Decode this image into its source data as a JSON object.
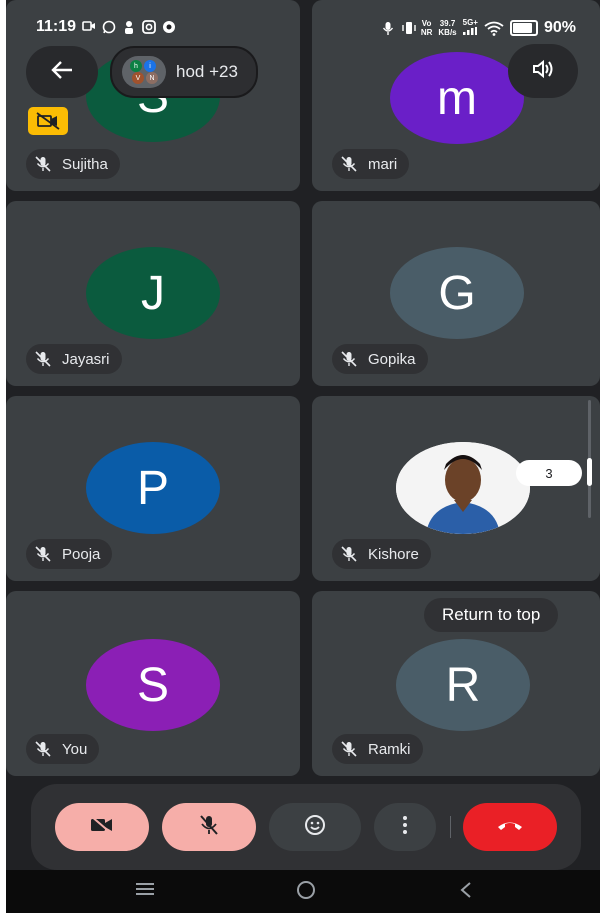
{
  "status_bar": {
    "time": "11:19",
    "net_speed_value": "39.7",
    "net_speed_unit": "KB/s",
    "volte_top": "Vo",
    "volte_bottom": "NR",
    "network": "5G+",
    "battery": "90%"
  },
  "header": {
    "back_icon": "arrow-left-icon",
    "meeting_label": "hod +23",
    "participant_avatars": [
      "h",
      "i",
      "V",
      "N"
    ],
    "speaker_icon": "volume-icon"
  },
  "tiles": [
    {
      "name": "Sujitha",
      "initial": "S",
      "color": "#0b5b3e",
      "mic_muted": true,
      "camera_off_badge": true
    },
    {
      "name": "mari",
      "initial": "m",
      "color": "#6a1fc8",
      "mic_muted": true
    },
    {
      "name": "Jayasri",
      "initial": "J",
      "color": "#0b5b3e",
      "mic_muted": true
    },
    {
      "name": "Gopika",
      "initial": "G",
      "color": "#4a5d68",
      "mic_muted": true
    },
    {
      "name": "Pooja",
      "initial": "P",
      "color": "#0a5ca8",
      "mic_muted": true
    },
    {
      "name": "Kishore",
      "initial": "",
      "color": "#ffffff",
      "mic_muted": true,
      "has_photo": true,
      "reaction_count": "3"
    },
    {
      "name": "You",
      "initial": "S",
      "color": "#8b1fb5",
      "mic_muted": true
    },
    {
      "name": "Ramki",
      "initial": "R",
      "color": "#4a5d68",
      "mic_muted": true
    }
  ],
  "return_to_top": "Return to top",
  "controls": {
    "camera": "camera-off-icon",
    "mic": "mic-off-icon",
    "reactions": "emoji-icon",
    "more": "more-vert-icon",
    "end_call": "end-call-icon",
    "camera_color": "#f6aea9",
    "mic_color": "#f6aea9",
    "end_color": "#ea2026"
  },
  "nav": {
    "recents": "recents-icon",
    "home": "home-icon",
    "back": "back-icon"
  }
}
